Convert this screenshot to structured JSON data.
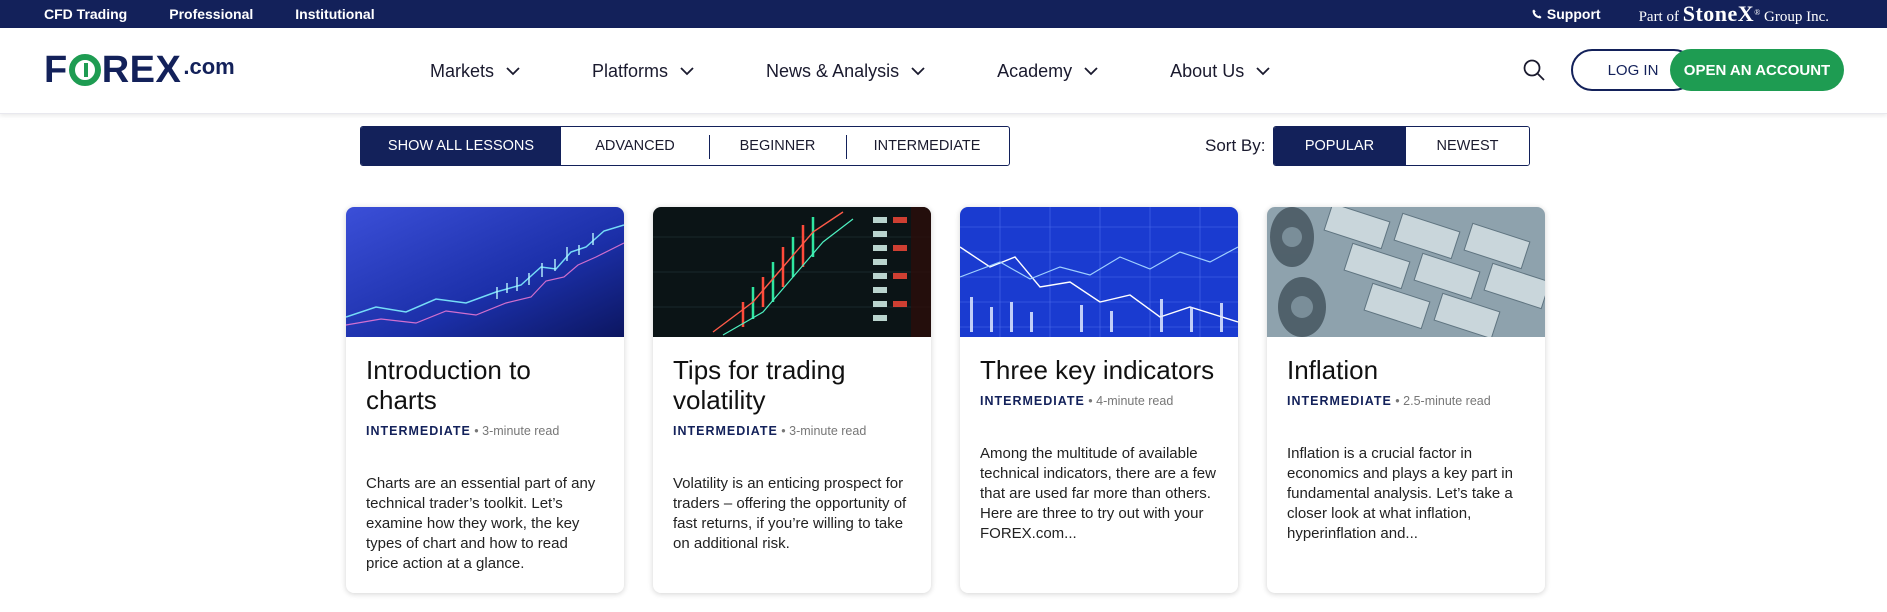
{
  "topbar": {
    "links": [
      "CFD Trading",
      "Professional",
      "Institutional"
    ],
    "support": "Support",
    "partof_prefix": "Part of",
    "partof_brand": "StoneX",
    "partof_tm": "®",
    "partof_suffix": "Group Inc."
  },
  "logo": {
    "brand_f": "F",
    "brand_rest": "REX",
    "dotcom": ".com"
  },
  "nav": {
    "items": [
      "Markets",
      "Platforms",
      "News & Analysis",
      "Academy",
      "About Us"
    ],
    "login": "LOG IN",
    "open_account": "OPEN AN ACCOUNT"
  },
  "filters": {
    "level_options": [
      "SHOW ALL LESSONS",
      "ADVANCED",
      "BEGINNER",
      "INTERMEDIATE"
    ],
    "active_level": "SHOW ALL LESSONS",
    "sort_label": "Sort By:",
    "sort_options": [
      "POPULAR",
      "NEWEST"
    ],
    "active_sort": "POPULAR"
  },
  "cards": [
    {
      "title": "Introduction to charts",
      "level": "INTERMEDIATE",
      "read_time": "3-minute read",
      "description": "Charts are an essential part of any technical trader’s toolkit. Let’s examine how they work, the key types of chart and how to read price action at a glance."
    },
    {
      "title": "Tips for trading volatility",
      "level": "INTERMEDIATE",
      "read_time": "3-minute read",
      "description": "Volatility is an enticing prospect for traders – offering the opportunity of fast returns, if you’re willing to take on additional risk."
    },
    {
      "title": "Three key indicators",
      "level": "INTERMEDIATE",
      "read_time": "4-minute read",
      "description": "Among the multitude of available technical indicators, there are a few that are used far more than others. Here are three to try out with your FOREX.com..."
    },
    {
      "title": "Inflation",
      "level": "INTERMEDIATE",
      "read_time": "2.5-minute read",
      "description": "Inflation is a crucial factor in economics and plays a key part in fundamental analysis. Let’s take a closer look at what inflation, hyperinflation and..."
    }
  ],
  "colors": {
    "navy": "#13215a",
    "green": "#1e9c52"
  }
}
